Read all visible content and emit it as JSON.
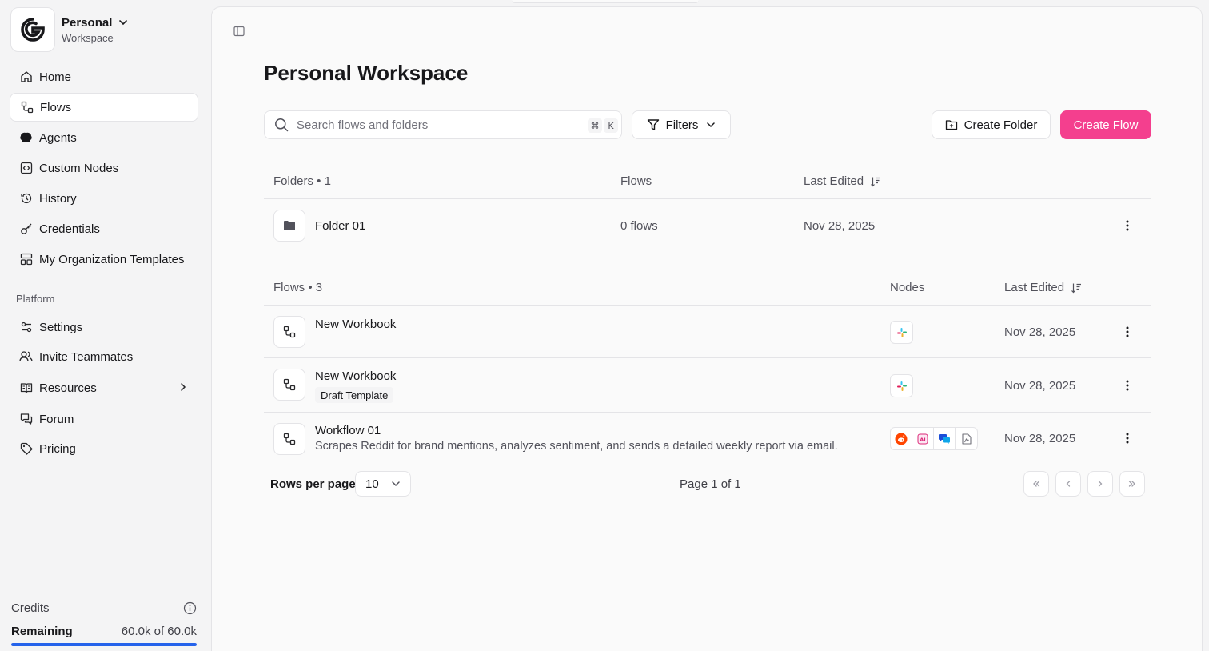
{
  "workspace": {
    "name": "Personal",
    "subtitle": "Workspace"
  },
  "nav": {
    "home": "Home",
    "flows": "Flows",
    "agents": "Agents",
    "custom_nodes": "Custom Nodes",
    "history": "History",
    "credentials": "Credentials",
    "org_templates": "My Organization Templates",
    "platform_label": "Platform",
    "settings": "Settings",
    "invite": "Invite Teammates",
    "resources": "Resources",
    "forum": "Forum",
    "pricing": "Pricing"
  },
  "credits": {
    "label": "Credits",
    "remaining_label": "Remaining",
    "remaining_value": "60.0k of 60.0k",
    "fraction": 1.0
  },
  "main": {
    "title": "Personal Workspace",
    "search_placeholder": "Search flows and folders",
    "shortcut_cmd": "⌘",
    "shortcut_key": "K",
    "filters_label": "Filters",
    "create_folder_label": "Create Folder",
    "create_flow_label": "Create Flow"
  },
  "folders_table": {
    "header_name": "Folders • 1",
    "header_flows": "Flows",
    "header_edited": "Last Edited",
    "rows": [
      {
        "name": "Folder 01",
        "flows": "0 flows",
        "edited": "Nov 28, 2025"
      }
    ]
  },
  "flows_table": {
    "header_name": "Flows • 3",
    "header_nodes": "Nodes",
    "header_edited": "Last Edited",
    "rows": [
      {
        "name": "New Workbook",
        "badge": "",
        "description": "",
        "nodes": [
          "slack-icon"
        ],
        "edited": "Nov 28, 2025"
      },
      {
        "name": "New Workbook",
        "badge": "Draft Template",
        "description": "",
        "nodes": [
          "slack-icon"
        ],
        "edited": "Nov 28, 2025"
      },
      {
        "name": "Workflow 01",
        "badge": "",
        "description": "Scrapes Reddit for brand mentions, analyzes sentiment, and sends a detailed weekly report via email.",
        "nodes": [
          "reddit-icon",
          "ai-icon",
          "chat-icon",
          "document-icon"
        ],
        "edited": "Nov 28, 2025"
      }
    ]
  },
  "pagination": {
    "rows_label": "Rows per page",
    "rows_value": "10",
    "page_info": "Page 1 of 1"
  },
  "colors": {
    "accent": "#f43f8e",
    "progress": "#2563eb",
    "border": "#e4e4e7"
  }
}
